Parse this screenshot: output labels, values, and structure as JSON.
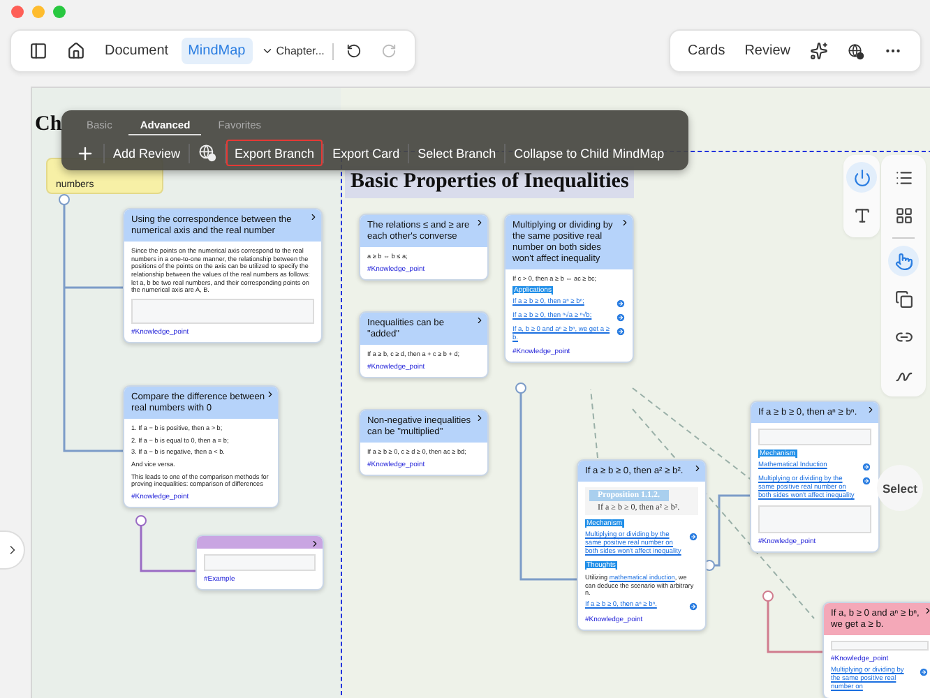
{
  "nav_tabs": [
    {
      "label": "Document",
      "selected": false
    },
    {
      "label": "MindMap",
      "selected": true
    }
  ],
  "chapter_menu": "Chapter...",
  "history": [
    {
      "kind": "undo",
      "disabled": false
    },
    {
      "kind": "redo",
      "disabled": true
    }
  ],
  "right_buttons": [
    "Cards",
    "Review"
  ],
  "canvas": {
    "title_visible": "Ch",
    "root_node": "numbers",
    "section_title": "Basic Properties of Inequalities"
  },
  "context_menu": {
    "tabs": [
      {
        "label": "Basic",
        "selected": false
      },
      {
        "label": "Advanced",
        "selected": true
      },
      {
        "label": "Favorites",
        "selected": false
      }
    ],
    "actions": [
      {
        "kind": "icon",
        "highlighted": false
      },
      {
        "kind": "text",
        "label": "Add Review",
        "highlighted": false
      },
      {
        "kind": "help",
        "highlighted": false
      },
      {
        "kind": "text",
        "label": "Export Branch",
        "highlighted": true
      },
      {
        "kind": "text",
        "label": "Export Card",
        "highlighted": false
      },
      {
        "kind": "text",
        "label": "Select Branch",
        "highlighted": false
      },
      {
        "kind": "text",
        "label": "Collapse to Child MindMap",
        "highlighted": false
      }
    ]
  },
  "cards": [
    {
      "title": "Using the correspondence between the numerical axis and the real number",
      "color": "#b6d3fa",
      "blocks": [
        {
          "kind": "text",
          "text": "Since the points on the numerical axis correspond to the real numbers in a one-to-one manner, the relationship between the positions of the points on the axis can be utilized to specify the relationship between the values of the real numbers as follows: let a, b be two real numbers, and their corresponding points on the numerical axis are A, B."
        },
        {
          "kind": "figure"
        },
        {
          "kind": "tag",
          "text": "#Knowledge_point"
        }
      ]
    },
    {
      "title": "Compare the difference between real numbers with 0",
      "color": "#b6d3fa",
      "blocks": [
        {
          "kind": "text",
          "text": "1. If a − b is positive, then a > b;"
        },
        {
          "kind": "text",
          "text": "2. If a − b is equal to 0, then a = b;"
        },
        {
          "kind": "text",
          "text": "3. If a − b is negative, then a < b."
        },
        {
          "kind": "text",
          "text": "And vice versa."
        },
        {
          "kind": "text",
          "text": "This leads to one of the comparison methods for proving inequalities: comparison of differences"
        },
        {
          "kind": "tag",
          "text": "#Knowledge_point"
        }
      ]
    },
    {
      "color": "#c9a5e2",
      "blocks": [
        {
          "kind": "figure"
        },
        {
          "kind": "tag",
          "text": "#Example"
        }
      ]
    },
    {
      "title": "The relations ≤ and ≥ are each other's converse",
      "color": "#b6d3fa",
      "blocks": [
        {
          "kind": "text",
          "text": "a ≥ b ⇔ b ≤ a;"
        },
        {
          "kind": "tag",
          "text": "#Knowledge_point"
        }
      ]
    },
    {
      "title": "Inequalities can be \"added\"",
      "color": "#b6d3fa",
      "blocks": [
        {
          "kind": "text",
          "text": "If a ≥ b, c ≥ d, then a + c ≥ b + d;"
        },
        {
          "kind": "tag",
          "text": "#Knowledge_point"
        }
      ]
    },
    {
      "title": "Non-negative inequalities can be \"multiplied\"",
      "color": "#b6d3fa",
      "blocks": [
        {
          "kind": "text",
          "text": "If a ≥ b ≥ 0, c ≥ d ≥ 0, then ac ≥ bd;"
        },
        {
          "kind": "tag",
          "text": "#Knowledge_point"
        }
      ]
    },
    {
      "title": "Multiplying or dividing by the same positive real number on both sides won't affect inequality",
      "color": "#b6d3fa",
      "blocks": [
        {
          "kind": "text",
          "text": "If c > 0, then a ≥ b ⇔ ac ≥ bc;"
        },
        {
          "kind": "label",
          "text": "Applications"
        },
        {
          "kind": "link",
          "text": "If a ≥ b ≥ 0, then aⁿ ≥ bⁿ;"
        },
        {
          "kind": "link",
          "text": "If a ≥ b ≥ 0, then ⁿ√a ≥ ⁿ√b;"
        },
        {
          "kind": "link",
          "text": "If a, b ≥ 0 and aⁿ ≥ bⁿ, we get a ≥ b."
        },
        {
          "kind": "tag",
          "text": "#Knowledge_point"
        }
      ]
    },
    {
      "title": "If a ≥ b ≥ 0, then a² ≥ b².",
      "color": "#b6d3fa",
      "blocks": [
        {
          "kind": "proposition",
          "heading": "Proposition 1.1.2.",
          "text": "If a ≥ b ≥ 0, then a² ≥ b²."
        },
        {
          "kind": "label",
          "text": "Mechanism"
        },
        {
          "kind": "link",
          "text": "Multiplying or dividing by the same positive real number on both sides won't affect inequality"
        },
        {
          "kind": "label",
          "text": "Thoughts"
        },
        {
          "kind": "inline_link",
          "before": "Utilizing ",
          "link": "mathematical induction",
          "after": ", we can deduce the scenario with arbitrary n."
        },
        {
          "kind": "link",
          "text": "If a ≥ b ≥ 0, then aⁿ ≥ bⁿ."
        },
        {
          "kind": "tag",
          "text": "#Knowledge_point"
        }
      ]
    },
    {
      "title": "If a ≥ b ≥ 0, then aⁿ ≥ bⁿ.",
      "color": "#b6d3fa",
      "blocks": [
        {
          "kind": "figure"
        },
        {
          "kind": "label",
          "text": "Mechanism"
        },
        {
          "kind": "link",
          "text": "Mathematical Induction"
        },
        {
          "kind": "link",
          "text": "Multiplying or dividing by the same positive real number on both sides won't affect inequality"
        },
        {
          "kind": "diagram"
        },
        {
          "kind": "tag",
          "text": "#Knowledge_point"
        }
      ]
    },
    {
      "title": "If a, b ≥ 0 and aⁿ ≥ bⁿ, we get a ≥ b.",
      "color": "#f4a8b8",
      "blocks": [
        {
          "kind": "figure"
        },
        {
          "kind": "tag",
          "text": "#Knowledge_point"
        },
        {
          "kind": "link",
          "text": "Multiplying or dividing by the same positive real number on"
        }
      ]
    }
  ],
  "tool_panel_top": [
    {
      "kind": "power",
      "selected": true
    },
    {
      "kind": "text",
      "selected": false
    }
  ],
  "tool_panel_side": [
    {
      "kind": "list",
      "selected": false
    },
    {
      "kind": "layout",
      "selected": false
    },
    {
      "kind": "hand",
      "selected": true
    },
    {
      "kind": "copy",
      "selected": false
    },
    {
      "kind": "link",
      "selected": false
    },
    {
      "kind": "squiggle",
      "selected": false
    }
  ],
  "select_button": "Select"
}
